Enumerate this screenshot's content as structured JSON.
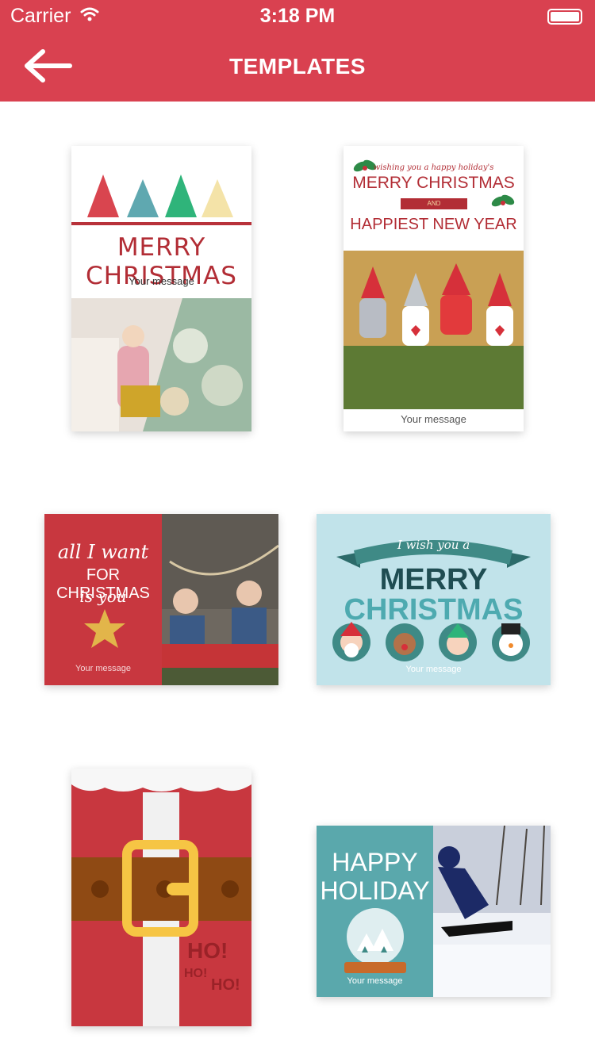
{
  "status_bar": {
    "carrier": "Carrier",
    "time": "3:18 PM"
  },
  "nav": {
    "title": "TEMPLATES",
    "back_icon": "arrow-left-icon"
  },
  "colors": {
    "header": "#d94150",
    "card_red": "#c8373f",
    "card_teal": "#5aa8ac",
    "card_lightblue": "#c1e3ea"
  },
  "templates": [
    {
      "heading": "MERRY CHRISTMAS",
      "message": "Your message"
    },
    {
      "top_script": "wishing you a happy holiday's",
      "heading": "MERRY CHRISTMAS",
      "ribbon": "AND",
      "subheading": "HAPPIEST NEW YEAR",
      "message": "Your message"
    },
    {
      "line1": "all I want",
      "line2": "FOR CHRISTMAS",
      "line3": "is you",
      "message": "Your message"
    },
    {
      "ribbon": "I wish you a",
      "line1": "MERRY",
      "line2": "CHRISTMAS",
      "message": "Your message"
    },
    {
      "text_main": "HO!",
      "text_small1": "HO!",
      "text_small2": "HO!"
    },
    {
      "line1": "HAPPY",
      "line2": "HOLIDAY",
      "message": "Your message"
    }
  ]
}
